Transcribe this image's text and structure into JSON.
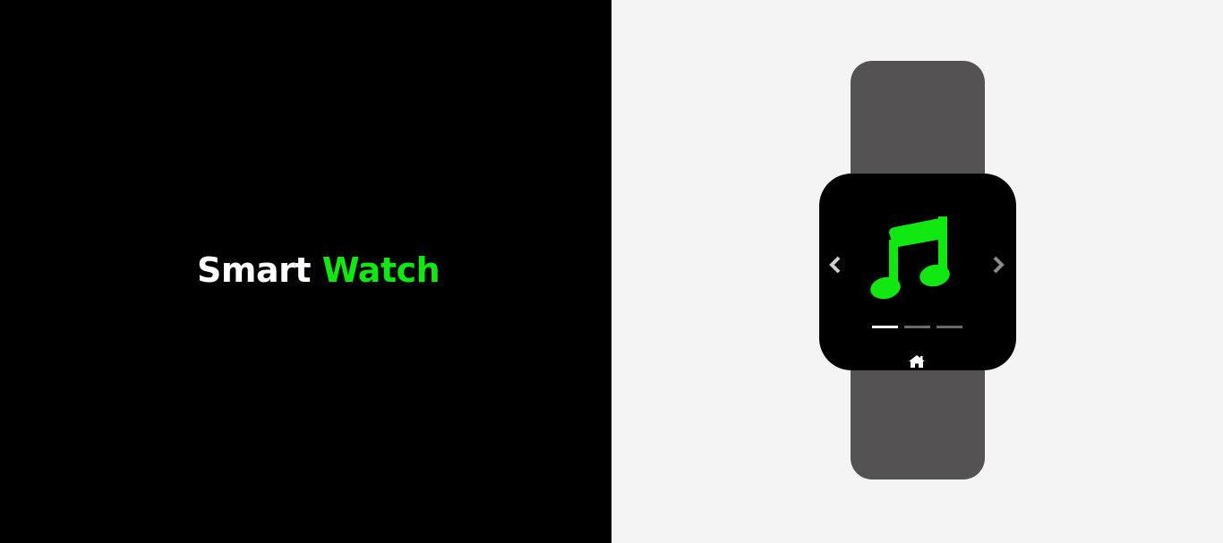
{
  "brand": {
    "title_first": "Smart",
    "title_second": "Watch",
    "first_color": "#ffffff",
    "accent_color": "#11e811"
  },
  "watch": {
    "strap_color": "#545253",
    "face_color": "#000000",
    "current_app": {
      "icon": "music-note-icon",
      "icon_color": "#11e811"
    },
    "navigation": {
      "prev_icon": "chevron-left-icon",
      "next_icon": "chevron-right-icon",
      "prev_color": "#cfcfcf",
      "next_color": "#8a8a8a"
    },
    "pager": {
      "total_pages": 3,
      "active_page": 1
    },
    "home_icon": "home-icon"
  },
  "background": {
    "left": "#000000",
    "right": "#f4f4f4"
  }
}
